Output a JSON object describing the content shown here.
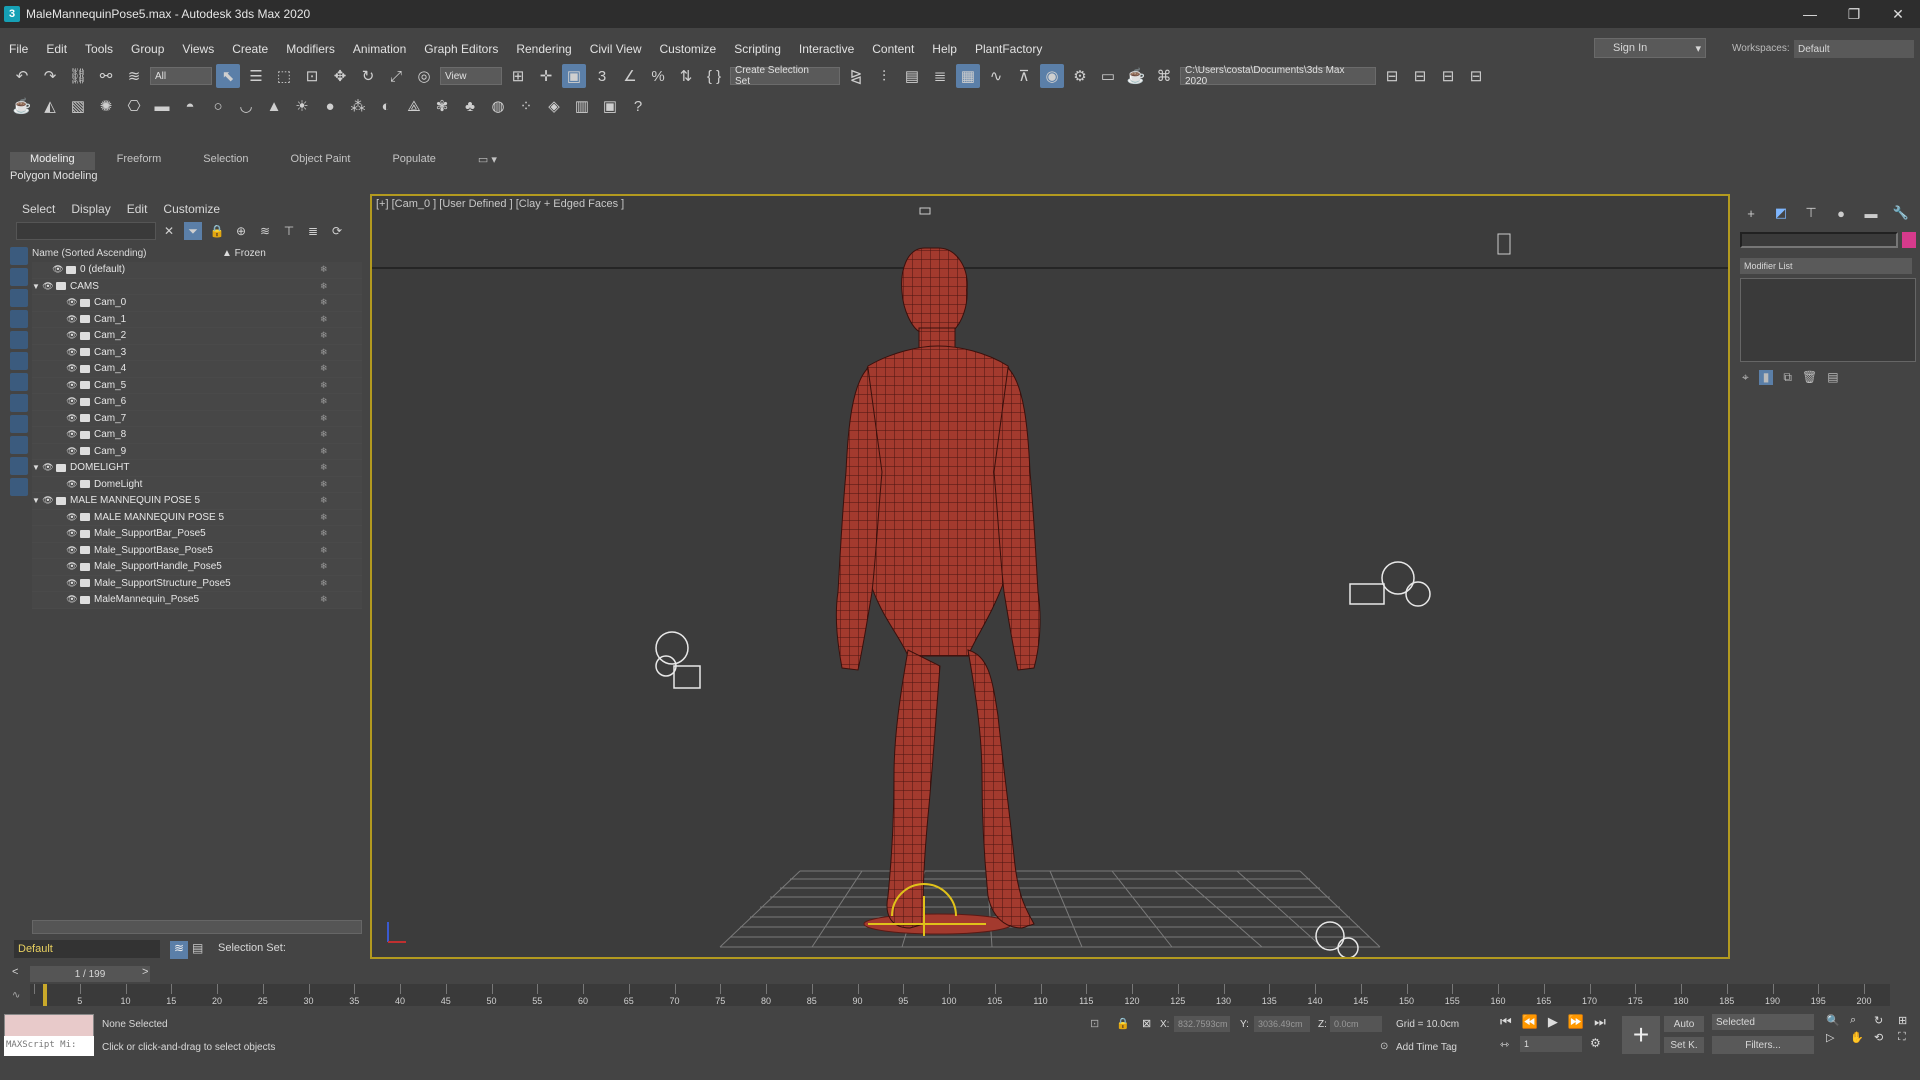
{
  "window": {
    "title": "MaleMannequinPose5.max - Autodesk 3ds Max 2020",
    "app_icon": "3"
  },
  "menu": [
    "File",
    "Edit",
    "Tools",
    "Group",
    "Views",
    "Create",
    "Modifiers",
    "Animation",
    "Graph Editors",
    "Rendering",
    "Civil View",
    "Customize",
    "Scripting",
    "Interactive",
    "Content",
    "Help",
    "PlantFactory"
  ],
  "account": {
    "sign_in": "Sign In",
    "workspaces_label": "Workspaces:",
    "workspace": "Default"
  },
  "toolbar": {
    "filter": "All",
    "ref_coord": "View",
    "selection_set": "Create Selection Set",
    "project_path": "C:\\Users\\costa\\Documents\\3ds Max 2020"
  },
  "ribbon": {
    "tabs": [
      "Modeling",
      "Freeform",
      "Selection",
      "Object Paint",
      "Populate"
    ],
    "panel": "Polygon Modeling"
  },
  "scene_explorer": {
    "menu": [
      "Select",
      "Display",
      "Edit",
      "Customize"
    ],
    "col_name": "Name (Sorted Ascending)",
    "col_frozen": "▲ Frozen",
    "rows": [
      {
        "label": "0 (default)",
        "level": 1,
        "arrow": ""
      },
      {
        "label": "CAMS",
        "level": 0,
        "arrow": "▼"
      },
      {
        "label": "Cam_0",
        "level": 2,
        "arrow": ""
      },
      {
        "label": "Cam_1",
        "level": 2,
        "arrow": ""
      },
      {
        "label": "Cam_2",
        "level": 2,
        "arrow": ""
      },
      {
        "label": "Cam_3",
        "level": 2,
        "arrow": ""
      },
      {
        "label": "Cam_4",
        "level": 2,
        "arrow": ""
      },
      {
        "label": "Cam_5",
        "level": 2,
        "arrow": ""
      },
      {
        "label": "Cam_6",
        "level": 2,
        "arrow": ""
      },
      {
        "label": "Cam_7",
        "level": 2,
        "arrow": ""
      },
      {
        "label": "Cam_8",
        "level": 2,
        "arrow": ""
      },
      {
        "label": "Cam_9",
        "level": 2,
        "arrow": ""
      },
      {
        "label": "DOMELIGHT",
        "level": 0,
        "arrow": "▼"
      },
      {
        "label": "DomeLight",
        "level": 2,
        "arrow": ""
      },
      {
        "label": "MALE MANNEQUIN POSE 5",
        "level": 0,
        "arrow": "▼"
      },
      {
        "label": "MALE MANNEQUIN POSE 5",
        "level": 2,
        "arrow": ""
      },
      {
        "label": "Male_SupportBar_Pose5",
        "level": 2,
        "arrow": ""
      },
      {
        "label": "Male_SupportBase_Pose5",
        "level": 2,
        "arrow": ""
      },
      {
        "label": "Male_SupportHandle_Pose5",
        "level": 2,
        "arrow": ""
      },
      {
        "label": "Male_SupportStructure_Pose5",
        "level": 2,
        "arrow": ""
      },
      {
        "label": "MaleMannequin_Pose5",
        "level": 2,
        "arrow": ""
      }
    ],
    "layer": "Default",
    "selection_set_label": "Selection Set:"
  },
  "viewport": {
    "label": "[+] [Cam_0 ] [User Defined ] [Clay + Edged Faces ]"
  },
  "command_panel": {
    "modifier_list": "Modifier List",
    "object_color": "#d63a8c"
  },
  "timeline": {
    "frame": "1 / 199",
    "ticks": [
      "5",
      "10",
      "15",
      "20",
      "25",
      "30",
      "35",
      "40",
      "45",
      "50",
      "55",
      "60",
      "65",
      "70",
      "75",
      "80",
      "85",
      "90",
      "95",
      "100",
      "105",
      "110",
      "115",
      "120",
      "125",
      "130",
      "135",
      "140",
      "145",
      "150",
      "155",
      "160",
      "165",
      "170",
      "175",
      "180",
      "185",
      "190",
      "195",
      "200"
    ]
  },
  "status": {
    "maxscript": "MAXScript Mi:",
    "selection": "None Selected",
    "prompt": "Click or click-and-drag to select objects",
    "x_label": "X:",
    "x": "832.7593cm",
    "y_label": "Y:",
    "y": "3036.49cm",
    "z_label": "Z:",
    "z": "0.0cm",
    "grid": "Grid = 10.0cm",
    "add_time_tag": "Add Time Tag",
    "auto": "Auto",
    "set_key": "Set K.",
    "selected": "Selected",
    "filters": "Filters...",
    "frame_field": "1"
  }
}
